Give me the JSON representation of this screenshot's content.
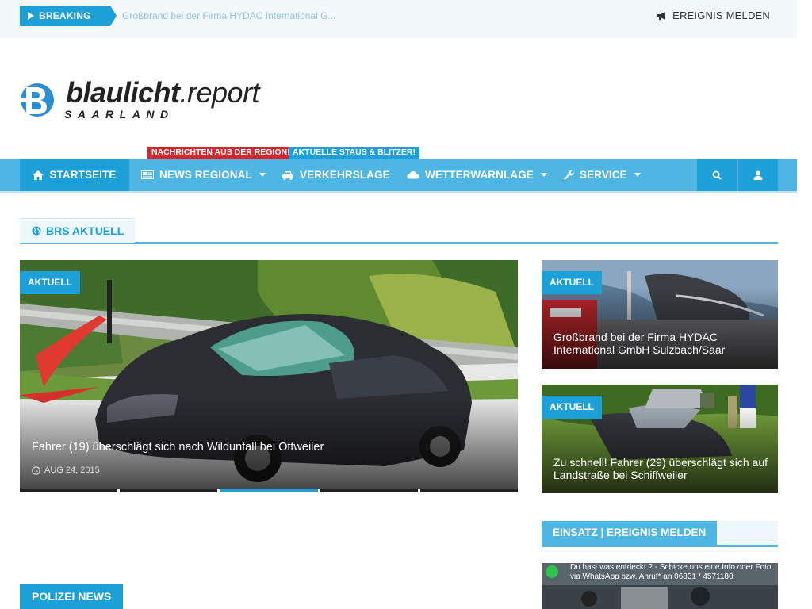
{
  "topbar": {
    "breaking_label": "BREAKING",
    "breaking_text": "Großbrand bei der Firma HYDAC International G...",
    "report_label": "EREIGNIS MELDEN"
  },
  "logo": {
    "main_bold": "blaulicht",
    "main_light": ".report",
    "sub": "SAARLAND"
  },
  "nav": {
    "badges": [
      "NACHRICHTEN AUS DER REGION!",
      "AKTUELLE STAUS & BLITZER!"
    ],
    "items": [
      {
        "label": "STARTSEITE",
        "icon": "home-icon"
      },
      {
        "label": "NEWS REGIONAL",
        "icon": "newspaper-icon"
      },
      {
        "label": "VERKEHRSLAGE",
        "icon": "car-icon"
      },
      {
        "label": "WETTERWARNLAGE",
        "icon": "cloud-icon"
      },
      {
        "label": "SERVICE",
        "icon": "wrench-icon"
      }
    ],
    "search_icon": "search-icon",
    "user_icon": "user-icon"
  },
  "section": {
    "title": "BRS AKTUELL"
  },
  "main_story": {
    "tag": "AKTUELL",
    "title": "Fahrer (19) überschlägt sich nach Wildunfall bei Ottweiler",
    "date": "AUG 24, 2015"
  },
  "slider": {
    "count": 5,
    "active": 3
  },
  "side_stories": [
    {
      "tag": "AKTUELL",
      "title": "Großbrand bei der Firma HYDAC International GmbH Sulzbach/Saar"
    },
    {
      "tag": "AKTUELL",
      "title": "Zu schnell! Fahrer (29) überschlägt sich auf Landstraße bei Schiffweiler"
    }
  ],
  "sidebar": {
    "einsatz_title": "EINSATZ | EREIGNIS MELDEN",
    "whatsapp_text": "Du hast was entdeckt ? - Schicke uns eine Info oder Foto via WhatsApp bzw. Anruf* an 06831 / 4571180"
  },
  "polizei": {
    "title": "POLIZEI NEWS"
  },
  "colors": {
    "accent": "#1d9fd8",
    "nav": "#4fb6e3",
    "badge_red": "#d9232d"
  }
}
